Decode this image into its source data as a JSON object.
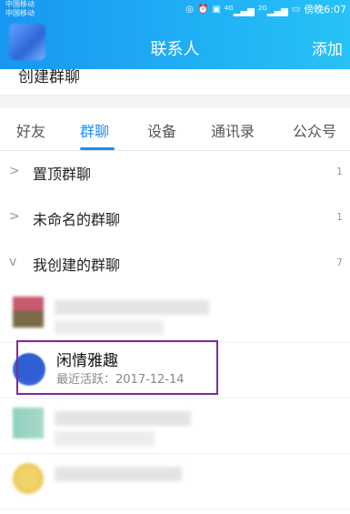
{
  "status_bar": {
    "carrier_1": "中国移动",
    "carrier_2": "中国移动",
    "icons": [
      "nfc-icon",
      "alarm-icon",
      "hd-icon",
      "signal-4g-icon",
      "signal-2g-icon",
      "battery-icon"
    ],
    "signal_4g": "4G",
    "signal_2g": "2G",
    "time_text": "傍晚6:07"
  },
  "header": {
    "title": "联系人",
    "add_label": "添加"
  },
  "create_group": {
    "label": "创建群聊",
    "chevron": ">"
  },
  "tabs": [
    {
      "label": "好友"
    },
    {
      "label": "群聊",
      "active": true
    },
    {
      "label": "设备"
    },
    {
      "label": "通讯录"
    },
    {
      "label": "公众号"
    }
  ],
  "groups": [
    {
      "label": "置顶群聊",
      "count": "1",
      "arrow": ">"
    },
    {
      "label": "未命名的群聊",
      "count": "1",
      "arrow": ">"
    },
    {
      "label": "我创建的群聊",
      "count": "7",
      "arrow": "v"
    }
  ],
  "highlighted_group": {
    "name": "闲情雅趣",
    "last_active": "最近活跃：2017-12-14"
  },
  "colors": {
    "header_start": "#1797f1",
    "header_end": "#27c2f7",
    "accent": "#1a8ef5",
    "highlight_border": "#7d2a9a"
  }
}
